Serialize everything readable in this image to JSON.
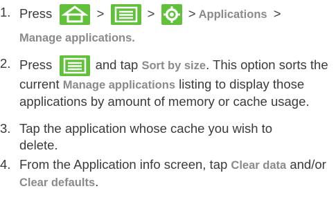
{
  "steps": [
    {
      "number": "1.",
      "press": "Press",
      "sep": ">",
      "apps_label": "Applications",
      "manage_label": "Manage applications."
    },
    {
      "number": "2.",
      "press": "Press",
      "text_a": " and tap ",
      "sort_label": "Sort by size",
      "text_b": ". This option sorts the current ",
      "manage_label": "Manage applications",
      "text_c": " listing to display those applications by amount of memory or cache usage."
    },
    {
      "number": "3.",
      "text": "Tap the application whose cache you wish to delete."
    },
    {
      "number": "4.",
      "text_a": "From the Application info screen, tap ",
      "clear_data": "Clear data",
      "text_b": " and/or ",
      "clear_defaults": "Clear defaults",
      "text_c": "."
    }
  ],
  "icons": {
    "home": "home-icon",
    "menu": "menu-icon",
    "settings": "settings-icon"
  },
  "colors": {
    "icon_green": "#62c13a",
    "bold_gray": "#8a8a8a",
    "text": "#3a3a3a"
  }
}
